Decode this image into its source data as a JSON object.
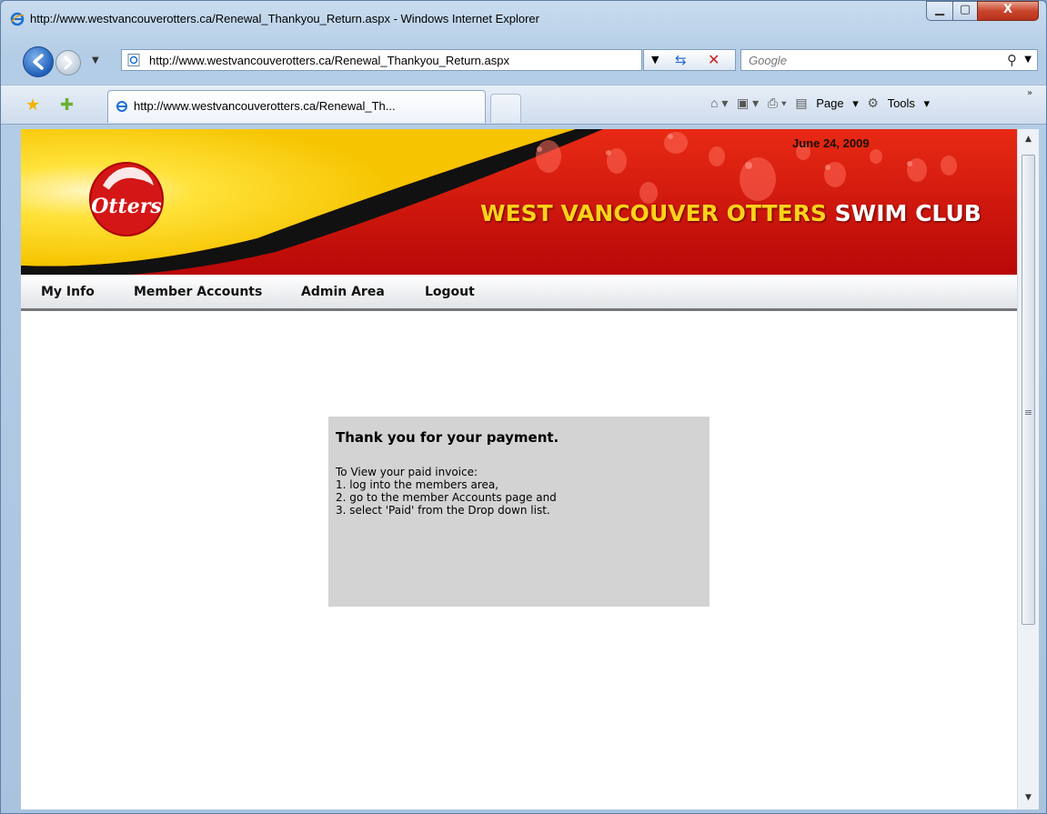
{
  "window": {
    "title": "http://www.westvancouverotters.ca/Renewal_Thankyou_Return.aspx - Windows Internet Explorer",
    "controls": {
      "minimize": "▁",
      "maximize": "▢",
      "close": "X"
    }
  },
  "address_bar": {
    "url": "http://www.westvancouverotters.ca/Renewal_Thankyou_Return.aspx"
  },
  "search_box": {
    "placeholder": "Google"
  },
  "tabs": [
    {
      "label": "http://www.westvancouverotters.ca/Renewal_Th..."
    }
  ],
  "command_bar": {
    "page_label": "Page",
    "tools_label": "Tools"
  },
  "site": {
    "date": "June 24, 2009",
    "club_name_part1": "WEST VANCOUVER OTTERS",
    "club_name_part2": "SWIM CLUB",
    "logo_text": "Otters",
    "menu": [
      {
        "label": "My Info"
      },
      {
        "label": "Member Accounts"
      },
      {
        "label": "Admin Area"
      },
      {
        "label": "Logout"
      }
    ]
  },
  "message": {
    "heading": "Thank you for your payment.",
    "lines": [
      "To View your paid invoice:",
      "1. log into the members area,",
      "2. go to the member Accounts page and",
      "3. select 'Paid' from the Drop down list."
    ]
  },
  "colors": {
    "banner_red": "#c40f0f",
    "banner_yellow": "#ffd21a",
    "message_bg": "#d3d3d3"
  }
}
